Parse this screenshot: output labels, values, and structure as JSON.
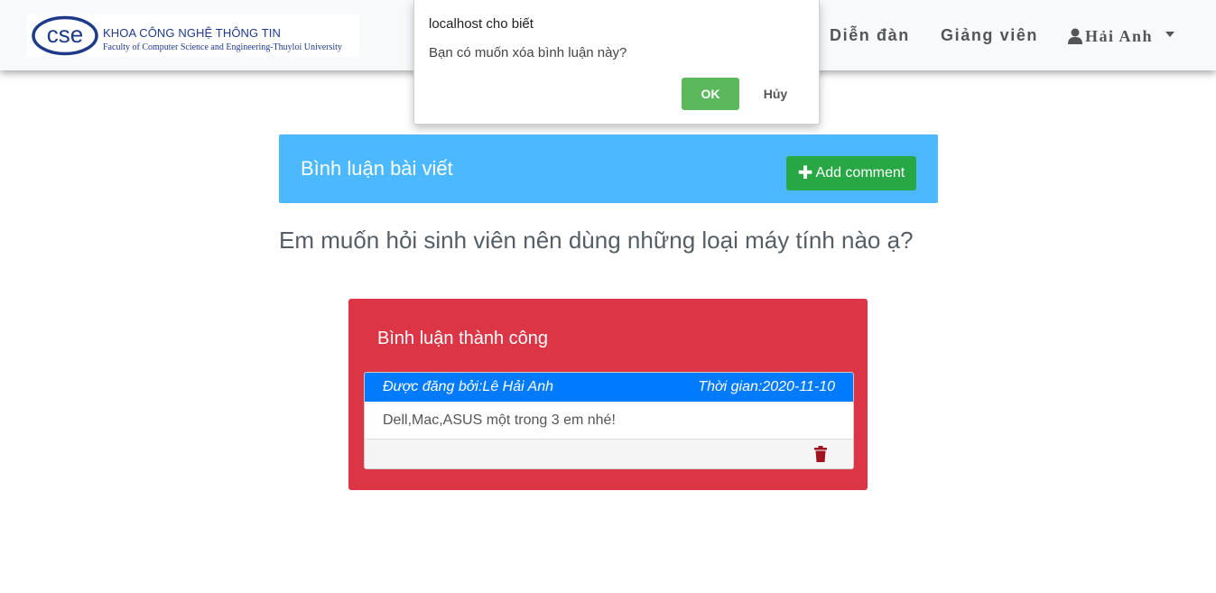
{
  "navbar": {
    "logo": {
      "mark_text": "cse",
      "line1": "KHOA CÔNG NGHỆ THÔNG TIN",
      "line2": "Faculty of Computer Science and Engineering-Thuyloi University"
    },
    "links": [
      {
        "label": "Diễn đàn"
      },
      {
        "label": "Giảng viên"
      }
    ],
    "user": {
      "name": "Hải Anh",
      "icon": "user-icon"
    },
    "brand_color": "#1e3a8a"
  },
  "dialog": {
    "title": "localhost cho biết",
    "message": "Bạn có muốn xóa bình luận này?",
    "ok_label": "OK",
    "cancel_label": "Hủy"
  },
  "comments_header": {
    "title": "Bình luận bài viết",
    "add_button_label": "Add comment",
    "background_color": "#4bb8ff"
  },
  "question": {
    "text": "Em muốn hỏi sinh viên nên dùng những loại máy tính nào ạ?"
  },
  "result_panel": {
    "title": "Bình luận thành công",
    "background_color": "#dc3545",
    "comment": {
      "posted_by": "Được đăng bởi:Lê Hải Anh",
      "time": "Thời gian:2020-11-10",
      "content": "Dell,Mac,ASUS một trong 3 em nhé!",
      "delete_icon": "trash-icon"
    }
  }
}
